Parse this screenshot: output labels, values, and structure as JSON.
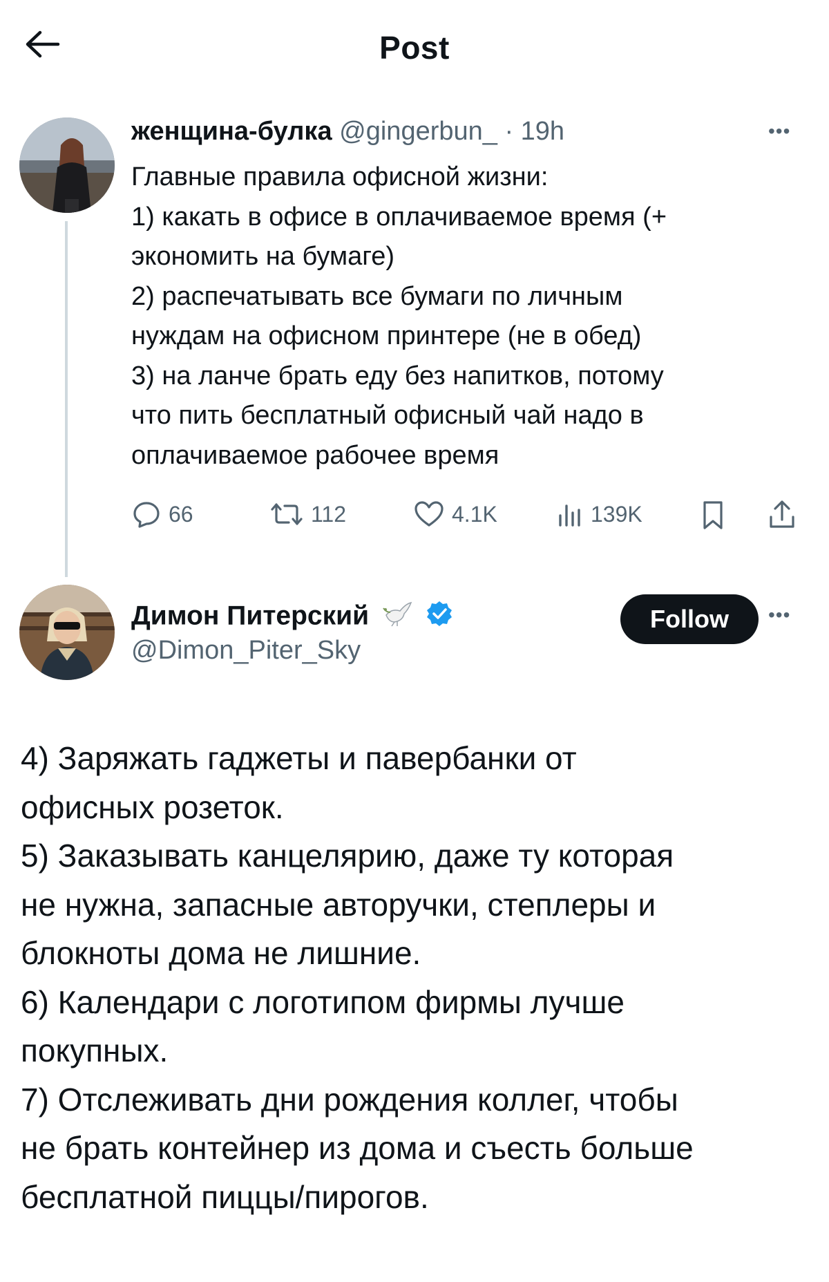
{
  "header": {
    "title": "Post"
  },
  "parent_tweet": {
    "author_name": "женщина-булка",
    "handle_time": "@gingerbun_ · 19h",
    "text_lines": [
      "Главные правила офисной жизни:",
      "1) какать в офисе в оплачиваемое время (+",
      "экономить на бумаге)",
      "2) распечатывать все бумаги по личным",
      "нуждам на офисном принтере (не в обед)",
      "3) на ланче брать еду без напитков, потому",
      "что пить бесплатный офисный чай надо в",
      "оплачиваемое рабочее время"
    ],
    "stats": {
      "replies": "66",
      "reposts": "112",
      "likes": "4.1K",
      "views": "139K"
    }
  },
  "reply_tweet": {
    "author_name": "Димон Питерский",
    "handle": "@Dimon_Piter_Sky",
    "follow_label": "Follow",
    "text_lines": [
      "4) Заряжать гаджеты и павербанки от",
      "офисных розеток.",
      "5) Заказывать канцелярию, даже ту которая",
      "не нужна, запасные авторучки, степлеры и",
      "блокноты дома не лишние.",
      "6) Календари с логотипом фирмы лучше",
      "покупных.",
      "7) Отслеживать дни рождения коллег, чтобы",
      "не брать контейнер из дома и съесть больше",
      "бесплатной пиццы/пирогов."
    ]
  },
  "colors": {
    "text": "#0f1419",
    "secondary": "#536471",
    "verified": "#1d9bf0",
    "thread_line": "#cfd9de"
  },
  "icons": [
    "back-arrow-icon",
    "reply-icon",
    "repost-icon",
    "like-icon",
    "views-icon",
    "bookmark-icon",
    "share-icon",
    "more-icon",
    "dove-icon",
    "verified-badge-icon"
  ]
}
